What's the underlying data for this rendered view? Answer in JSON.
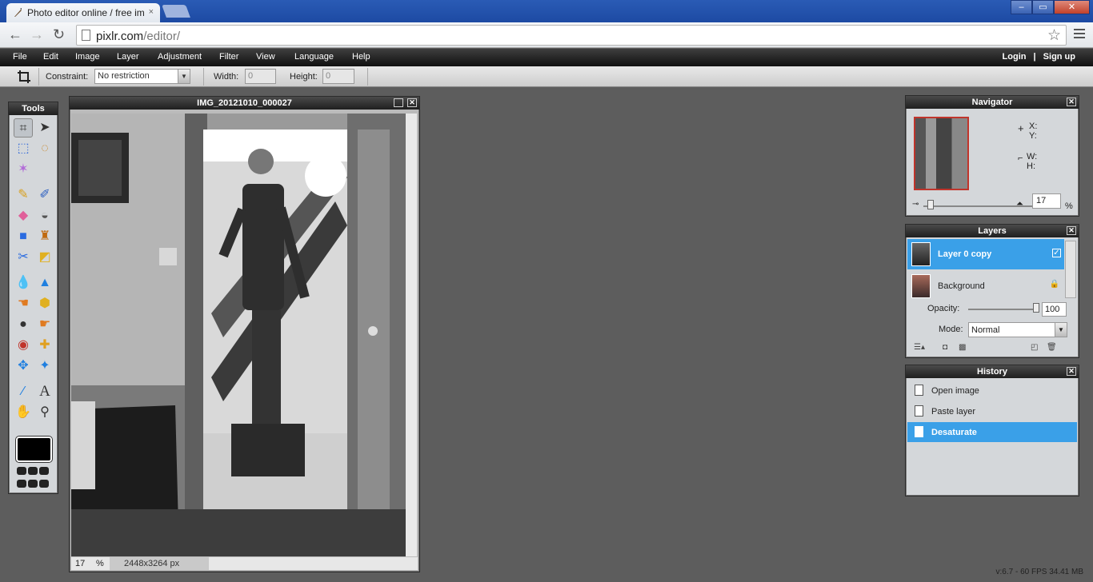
{
  "browser": {
    "tab_title": "Photo editor online / free im",
    "tab_close": "×",
    "url_host": "pixlr.com",
    "url_path": "/editor/",
    "back_icon": "arrow-left",
    "forward_icon": "arrow-right",
    "reload_icon": "reload",
    "star_icon": "star",
    "window_min": "–",
    "window_max": "▭",
    "window_close": "✕"
  },
  "menu": {
    "items": [
      "File",
      "Edit",
      "Image",
      "Layer",
      "Adjustment",
      "Filter",
      "View",
      "Language",
      "Help"
    ],
    "login": "Login",
    "separator": "|",
    "signup": "Sign up"
  },
  "options": {
    "constraint_label": "Constraint:",
    "constraint_value": "No restriction",
    "width_label": "Width:",
    "width_value": "0",
    "height_label": "Height:",
    "height_value": "0"
  },
  "tools": {
    "title": "Tools",
    "icons": [
      "crop",
      "move",
      "marquee",
      "lasso",
      "magic-wand",
      "pencil",
      "brush",
      "eraser",
      "paint-bucket",
      "gradient",
      "clone-stamp",
      "color-replace",
      "drawing-shapes",
      "blur",
      "sharpen",
      "smudge",
      "sponge",
      "dodge",
      "burn",
      "red-eye",
      "spot-heal",
      "bloat",
      "pinch",
      "color-picker",
      "type",
      "hand",
      "zoom"
    ]
  },
  "image_window": {
    "title": "IMG_20121010_000027",
    "zoom_value": "17",
    "zoom_unit": "%",
    "dimensions": "2448x3264 px"
  },
  "navigator": {
    "title": "Navigator",
    "x_label": "X:",
    "y_label": "Y:",
    "w_label": "W:",
    "h_label": "H:",
    "zoom_value": "17",
    "zoom_unit": "%"
  },
  "layers": {
    "title": "Layers",
    "items": [
      {
        "name": "Layer 0 copy",
        "selected": true,
        "visible_checked": true
      },
      {
        "name": "Background",
        "selected": false,
        "locked": true
      }
    ],
    "opacity_label": "Opacity:",
    "opacity_value": "100",
    "mode_label": "Mode:",
    "mode_value": "Normal"
  },
  "history": {
    "title": "History",
    "items": [
      {
        "label": "Open image",
        "selected": false
      },
      {
        "label": "Paste layer",
        "selected": false
      },
      {
        "label": "Desaturate",
        "selected": true
      }
    ]
  },
  "footer": {
    "version": "v:6.7 - 60 FPS 34.41 MB"
  },
  "colors": {
    "selection_blue": "#3aa0e8",
    "workspace_gray": "#5d5d5d",
    "navigator_frame": "#c0342b"
  }
}
